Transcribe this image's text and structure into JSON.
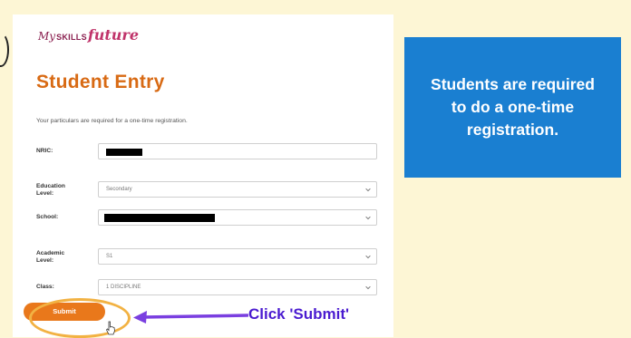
{
  "logo": {
    "my": "My",
    "skills": "SKILLS",
    "future": "future"
  },
  "page_title": "Student Entry",
  "subtitle": "Your particulars are required for a one-time registration.",
  "form": {
    "nric": {
      "label": "NRIC:",
      "value": ""
    },
    "education_level": {
      "label_line1": "Education",
      "label_line2": "Level:",
      "value": "Secondary"
    },
    "school": {
      "label": "School:",
      "value": ""
    },
    "academic_level": {
      "label_line1": "Academic",
      "label_line2": "Level:",
      "value": "S1"
    },
    "class": {
      "label": "Class:",
      "value": "1 DISCIPLINE"
    }
  },
  "submit_label": "Submit",
  "annotation": "Click 'Submit'",
  "callout": "Students are required to do a one-time registration.",
  "colors": {
    "background": "#fdf6d5",
    "title": "#d86a14",
    "submit": "#e9781b",
    "highlight_circle": "#f2b243",
    "arrow": "#7a3fe0",
    "annotation_text": "#4a1bd0",
    "callout_bg": "#1a7fd1"
  },
  "icons": [
    "chevron-down-icon",
    "cursor-hand-icon",
    "arrow-left-icon"
  ]
}
